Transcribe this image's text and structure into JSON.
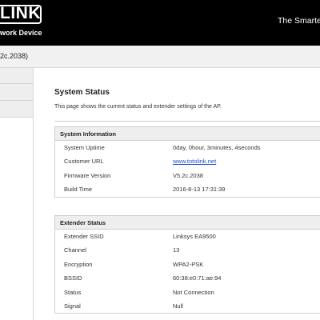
{
  "header": {
    "logo_text": "LINK",
    "logo_subtitle": "work Device",
    "tagline": "The Smartes"
  },
  "firmware_bar": {
    "text": "2c.2038)"
  },
  "page": {
    "title": "System Status",
    "description": "This page shows the current status and extender settings of the AP."
  },
  "system_information": {
    "heading": "System Information",
    "rows": [
      {
        "label": "System Uptime",
        "value": "0day, 0hour, 3minutes, 4seconds"
      },
      {
        "label": "Customer URL",
        "value": "www.totolink.net"
      },
      {
        "label": "Firmware Version",
        "value": "V5.2c.2038"
      },
      {
        "label": "Build Time",
        "value": "2016-8-13 17:31:39"
      }
    ]
  },
  "extender_status": {
    "heading": "Extender Status",
    "rows": [
      {
        "label": "Extender SSID",
        "value": "Linksys EA9500"
      },
      {
        "label": "Channel",
        "value": "13"
      },
      {
        "label": "Encryption",
        "value": "WPA2-PSK"
      },
      {
        "label": "BSSID",
        "value": "60:38:e0:71:ae:94"
      },
      {
        "label": "Status",
        "value": "Not Connection"
      },
      {
        "label": "Signal",
        "value": "Null"
      }
    ]
  }
}
